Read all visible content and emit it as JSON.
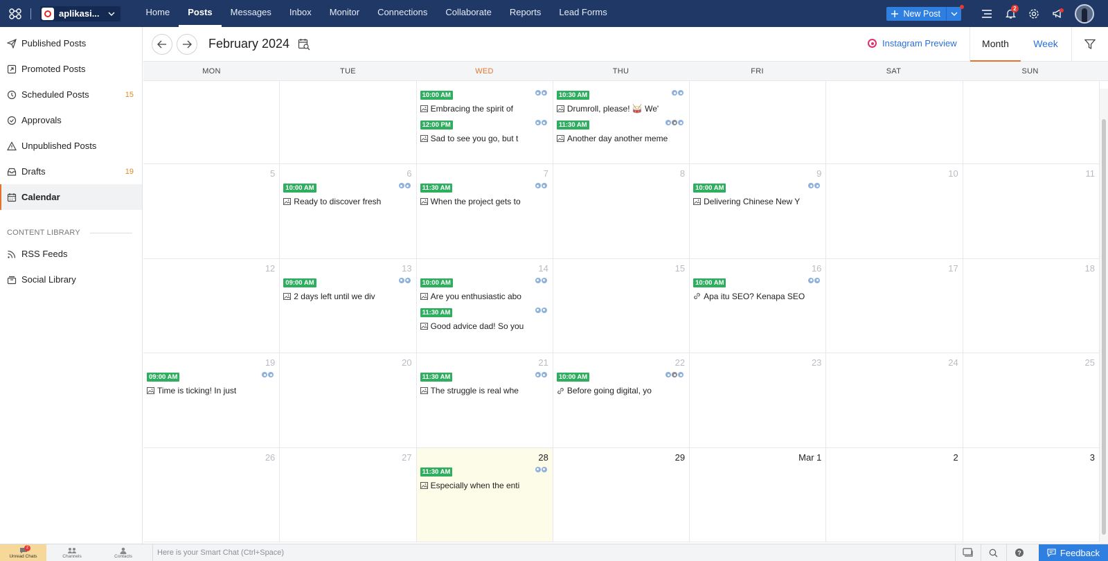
{
  "topbar": {
    "brand_name": "aplikasi...",
    "nav": [
      "Home",
      "Posts",
      "Messages",
      "Inbox",
      "Monitor",
      "Connections",
      "Collaborate",
      "Reports",
      "Lead Forms"
    ],
    "active_nav": "Posts",
    "new_post_label": "New Post",
    "notification_count": "2"
  },
  "sidebar": {
    "items": [
      {
        "label": "Published Posts",
        "icon": "send-icon",
        "count": ""
      },
      {
        "label": "Promoted Posts",
        "icon": "promote-icon",
        "count": ""
      },
      {
        "label": "Scheduled Posts",
        "icon": "clock-icon",
        "count": "15"
      },
      {
        "label": "Approvals",
        "icon": "check-circle-icon",
        "count": ""
      },
      {
        "label": "Unpublished Posts",
        "icon": "warning-icon",
        "count": ""
      },
      {
        "label": "Drafts",
        "icon": "drafts-icon",
        "count": "19"
      },
      {
        "label": "Calendar",
        "icon": "calendar-icon",
        "count": ""
      }
    ],
    "section_label": "CONTENT LIBRARY",
    "library_items": [
      {
        "label": "RSS Feeds",
        "icon": "rss-icon"
      },
      {
        "label": "Social Library",
        "icon": "library-icon"
      }
    ]
  },
  "header": {
    "month_title": "February 2024",
    "instagram_preview": "Instagram Preview",
    "view_tabs": [
      "Month",
      "Week"
    ],
    "active_view": "Month"
  },
  "calendar": {
    "days_of_week": [
      "MON",
      "TUE",
      "WED",
      "THU",
      "FRI",
      "SAT",
      "SUN"
    ],
    "today_dow": "WED",
    "weeks": [
      {
        "days": [
          {
            "num": "",
            "posts": []
          },
          {
            "num": "",
            "posts": []
          },
          {
            "num": "",
            "posts": [
              {
                "time": "10:00 AM",
                "text": "Embracing the spirit of",
                "kind": "image",
                "networks": [
                  "b",
                  "b"
                ]
              },
              {
                "time": "12:00 PM",
                "text": "Sad to see you go, but t",
                "kind": "image",
                "networks": [
                  "b",
                  "b"
                ]
              }
            ]
          },
          {
            "num": "",
            "posts": [
              {
                "time": "10:30 AM",
                "text": "Drumroll, please! 🥁 We'",
                "kind": "image",
                "networks": [
                  "b",
                  "b"
                ]
              },
              {
                "time": "11:30 AM",
                "text": "Another day another meme",
                "kind": "image",
                "networks": [
                  "b",
                  "g",
                  "b"
                ]
              }
            ]
          },
          {
            "num": "",
            "posts": []
          },
          {
            "num": "",
            "posts": []
          },
          {
            "num": "",
            "posts": []
          }
        ]
      },
      {
        "days": [
          {
            "num": "5",
            "posts": []
          },
          {
            "num": "6",
            "posts": [
              {
                "time": "10:00 AM",
                "text": "Ready to discover fresh",
                "kind": "image",
                "networks": [
                  "b",
                  "b"
                ]
              }
            ]
          },
          {
            "num": "7",
            "posts": [
              {
                "time": "11:30 AM",
                "text": "When the project gets to",
                "kind": "image",
                "networks": [
                  "b",
                  "b"
                ]
              }
            ]
          },
          {
            "num": "8",
            "posts": []
          },
          {
            "num": "9",
            "posts": [
              {
                "time": "10:00 AM",
                "text": "Delivering Chinese New Y",
                "kind": "image",
                "networks": [
                  "b",
                  "b"
                ]
              }
            ]
          },
          {
            "num": "10",
            "posts": []
          },
          {
            "num": "11",
            "posts": []
          }
        ]
      },
      {
        "days": [
          {
            "num": "12",
            "posts": []
          },
          {
            "num": "13",
            "posts": [
              {
                "time": "09:00 AM",
                "text": "2 days left until we div",
                "kind": "image",
                "networks": [
                  "b",
                  "b"
                ]
              }
            ]
          },
          {
            "num": "14",
            "posts": [
              {
                "time": "10:00 AM",
                "text": "Are you enthusiastic abo",
                "kind": "image",
                "networks": [
                  "b",
                  "b"
                ]
              },
              {
                "time": "11:30 AM",
                "text": "Good advice dad! So you",
                "kind": "image",
                "networks": [
                  "b",
                  "b"
                ]
              }
            ]
          },
          {
            "num": "15",
            "posts": []
          },
          {
            "num": "16",
            "posts": [
              {
                "time": "10:00 AM",
                "text": "Apa itu SEO? Kenapa SEO",
                "kind": "link",
                "networks": [
                  "b",
                  "b"
                ]
              }
            ]
          },
          {
            "num": "17",
            "posts": []
          },
          {
            "num": "18",
            "posts": []
          }
        ]
      },
      {
        "days": [
          {
            "num": "19",
            "posts": [
              {
                "time": "09:00 AM",
                "text": "Time is ticking! In just",
                "kind": "image",
                "networks": [
                  "b",
                  "b"
                ]
              }
            ]
          },
          {
            "num": "20",
            "posts": []
          },
          {
            "num": "21",
            "posts": [
              {
                "time": "11:30 AM",
                "text": "The struggle is real whe",
                "kind": "image",
                "networks": [
                  "b",
                  "b"
                ]
              }
            ]
          },
          {
            "num": "22",
            "posts": [
              {
                "time": "10:00 AM",
                "text": "Before going digital, yo",
                "kind": "link",
                "networks": [
                  "b",
                  "g",
                  "b"
                ]
              }
            ]
          },
          {
            "num": "23",
            "posts": []
          },
          {
            "num": "24",
            "posts": []
          },
          {
            "num": "25",
            "posts": []
          }
        ]
      },
      {
        "days": [
          {
            "num": "26",
            "posts": []
          },
          {
            "num": "27",
            "posts": []
          },
          {
            "num": "28",
            "today": true,
            "current": true,
            "posts": [
              {
                "time": "11:30 AM",
                "text": "Especially when the enti",
                "kind": "image",
                "networks": [
                  "b",
                  "b"
                ]
              }
            ]
          },
          {
            "num": "29",
            "current": true,
            "posts": []
          },
          {
            "num": "Mar 1",
            "current": true,
            "posts": []
          },
          {
            "num": "2",
            "current": true,
            "posts": []
          },
          {
            "num": "3",
            "current": true,
            "posts": []
          }
        ]
      }
    ]
  },
  "bottombar": {
    "items": [
      {
        "label": "Unread Chats",
        "badge": "2"
      },
      {
        "label": "Channels",
        "badge": ""
      },
      {
        "label": "Contacts",
        "badge": ""
      }
    ],
    "smart_chat_placeholder": "Here is your Smart Chat (Ctrl+Space)",
    "feedback_label": "Feedback"
  },
  "colors": {
    "topbar_bg": "#1f3866",
    "accent_orange": "#e5732e",
    "link_blue": "#2a6fdb",
    "time_green": "#2fae5f",
    "today_bg": "#fdfce9"
  }
}
